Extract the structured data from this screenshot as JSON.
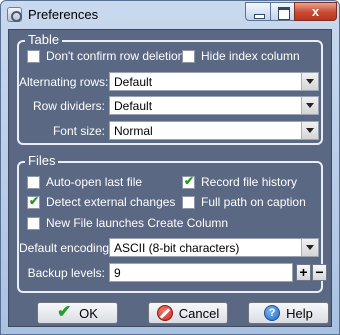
{
  "window": {
    "title": "Preferences",
    "close_glyph": "x"
  },
  "table_group": {
    "title": "Table",
    "dont_confirm_row_deletion": {
      "label": "Don't confirm row deletion",
      "checked": false
    },
    "hide_index_column": {
      "label": "Hide index column",
      "checked": false
    },
    "alternating_rows": {
      "label": "Alternating rows:",
      "value": "Default"
    },
    "row_dividers": {
      "label": "Row dividers:",
      "value": "Default"
    },
    "font_size": {
      "label": "Font size:",
      "value": "Normal"
    }
  },
  "files_group": {
    "title": "Files",
    "auto_open_last_file": {
      "label": "Auto-open last file",
      "checked": false
    },
    "record_file_history": {
      "label": "Record file history",
      "checked": true
    },
    "detect_external_changes": {
      "label": "Detect external changes",
      "checked": true
    },
    "full_path_on_caption": {
      "label": "Full path on caption",
      "checked": false
    },
    "new_file_launches_create_column": {
      "label": "New File launches Create Column",
      "checked": false
    },
    "default_encoding": {
      "label": "Default encoding:",
      "value": "ASCII (8-bit characters)"
    },
    "backup_levels": {
      "label": "Backup levels:",
      "value": "9",
      "plus": "+",
      "minus": "−"
    }
  },
  "buttons": {
    "ok": "OK",
    "cancel": "Cancel",
    "help": "Help",
    "help_glyph": "?"
  },
  "colors": {
    "panel": "#5b6883",
    "check": "#1f9b1f"
  },
  "icons": [
    "preferences-app-icon",
    "minimize-icon",
    "maximize-icon",
    "close-icon",
    "checkmark-icon",
    "cancel-icon",
    "help-icon",
    "chevron-down-icon"
  ]
}
